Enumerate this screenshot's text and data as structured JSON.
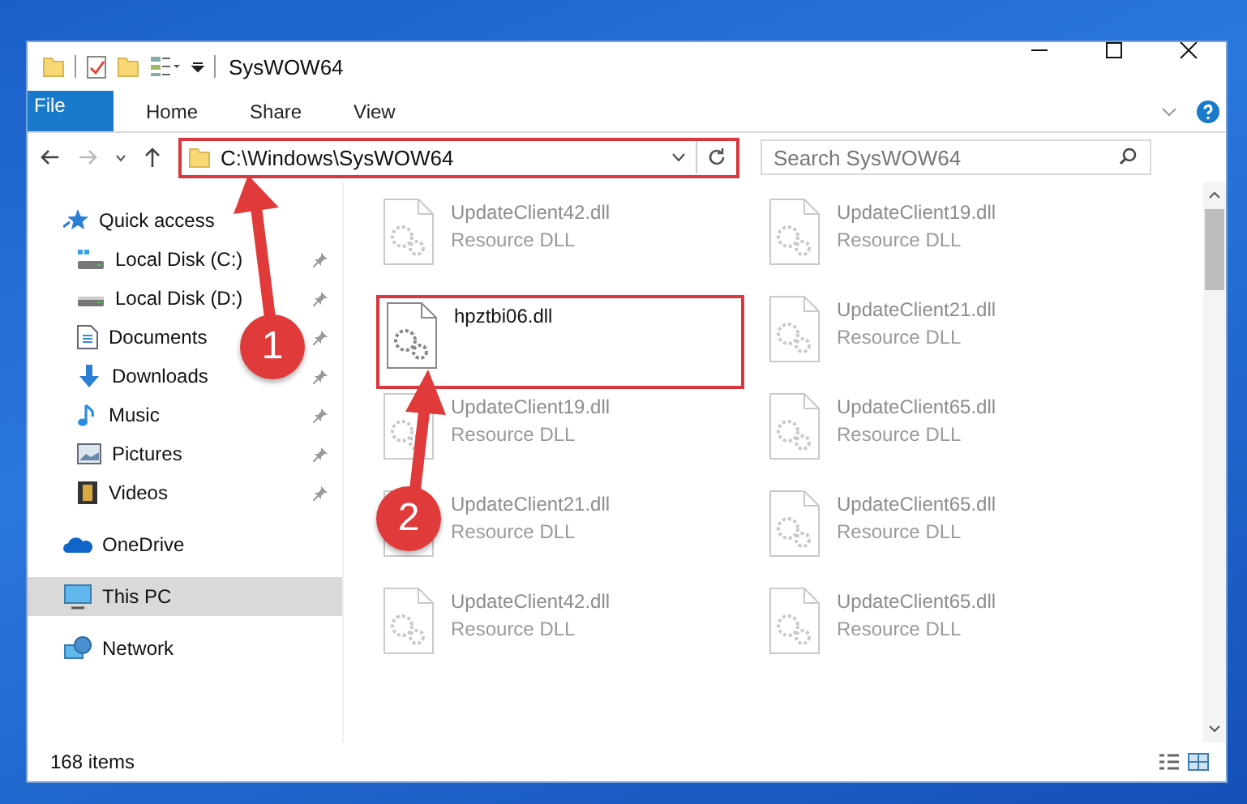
{
  "window": {
    "title": "SysWOW64"
  },
  "ribbon_tabs": [
    {
      "label": "File",
      "kind": "file",
      "selected": false
    },
    {
      "label": "Home",
      "kind": "tab",
      "selected": false
    },
    {
      "label": "Share",
      "kind": "tab",
      "selected": false
    },
    {
      "label": "View",
      "kind": "tab",
      "selected": false
    }
  ],
  "address": {
    "path": "C:\\Windows\\SysWOW64",
    "highlighted": true
  },
  "search": {
    "placeholder": "Search SysWOW64"
  },
  "sidebar": {
    "groups": [
      {
        "label": "Quick access",
        "kind": "star",
        "selected": false,
        "children": [
          {
            "label": "Local Disk (C:)",
            "kind": "disk-c",
            "pinned": true
          },
          {
            "label": "Local Disk (D:)",
            "kind": "disk",
            "pinned": true
          },
          {
            "label": "Documents",
            "kind": "doc",
            "pinned": true
          },
          {
            "label": "Downloads",
            "kind": "download",
            "pinned": true
          },
          {
            "label": "Music",
            "kind": "music",
            "pinned": true
          },
          {
            "label": "Pictures",
            "kind": "pictures",
            "pinned": true
          },
          {
            "label": "Videos",
            "kind": "videos",
            "pinned": true
          }
        ]
      },
      {
        "label": "OneDrive",
        "kind": "cloud",
        "selected": false
      },
      {
        "label": "This PC",
        "kind": "pc",
        "selected": true
      },
      {
        "label": "Network",
        "kind": "network",
        "selected": false
      }
    ]
  },
  "files": [
    {
      "name": "UpdateClient42.dll",
      "type": "Resource DLL",
      "dimmed": true,
      "highlighted": false
    },
    {
      "name": "UpdateClient19.dll",
      "type": "Resource DLL",
      "dimmed": true,
      "highlighted": false
    },
    {
      "name": "hpztbi06.dll",
      "dimmed": false,
      "highlighted": true
    },
    {
      "name": "UpdateClient21.dll",
      "type": "Resource DLL",
      "dimmed": true,
      "highlighted": false
    },
    {
      "name": "UpdateClient19.dll",
      "type": "Resource DLL",
      "dimmed": true,
      "highlighted": false
    },
    {
      "name": "UpdateClient65.dll",
      "type": "Resource DLL",
      "dimmed": true,
      "highlighted": false
    },
    {
      "name": "UpdateClient21.dll",
      "type": "Resource DLL",
      "dimmed": true,
      "highlighted": false
    },
    {
      "name": "UpdateClient65.dll",
      "type": "Resource DLL",
      "dimmed": true,
      "highlighted": false
    },
    {
      "name": "UpdateClient42.dll",
      "type": "Resource DLL",
      "dimmed": true,
      "highlighted": false
    },
    {
      "name": "UpdateClient65.dll",
      "type": "Resource DLL",
      "dimmed": true,
      "highlighted": false
    }
  ],
  "status_bar": {
    "count": "168 items"
  },
  "annotations": [
    {
      "label": "1"
    },
    {
      "label": "2"
    }
  ]
}
